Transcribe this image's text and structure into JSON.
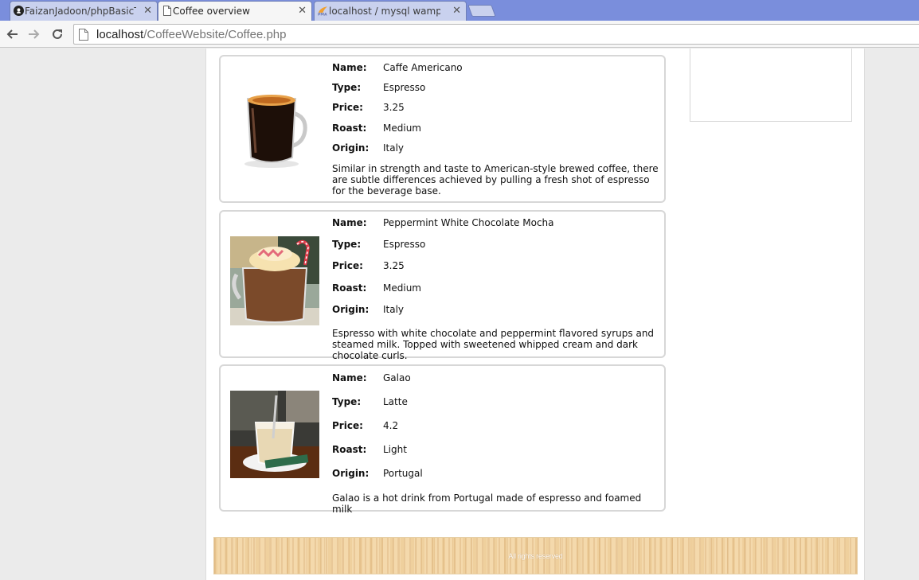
{
  "browser": {
    "tabs": [
      {
        "title": "FaizanJadoon/phpBasicTe",
        "icon": "github-icon"
      },
      {
        "title": "Coffee overview",
        "icon": "page-icon"
      },
      {
        "title": "localhost / mysql wampse",
        "icon": "phpmyadmin-icon"
      }
    ],
    "url": {
      "host": "localhost",
      "path": "/CoffeeWebsite/Coffee.php"
    }
  },
  "labels": {
    "name": "Name:",
    "type": "Type:",
    "price": "Price:",
    "roast": "Roast:",
    "origin": "Origin:"
  },
  "coffees": [
    {
      "name": "Caffe Americano",
      "type": "Espresso",
      "price": "3.25",
      "roast": "Medium",
      "origin": "Italy",
      "description": "Similar in strength and taste to American-style brewed coffee, there are subtle differences achieved by pulling a fresh shot of espresso for the beverage base.",
      "image": "americano-glass-image"
    },
    {
      "name": "Peppermint White Chocolate Mocha",
      "type": "Espresso",
      "price": "3.25",
      "roast": "Medium",
      "origin": "Italy",
      "description": "Espresso with white chocolate and peppermint flavored syrups and steamed milk. Topped with sweetened whipped cream and dark chocolate curls.",
      "image": "mocha-whipped-cream-image"
    },
    {
      "name": "Galao",
      "type": "Latte",
      "price": "4.2",
      "roast": "Light",
      "origin": "Portugal",
      "description": "Galao is a hot drink from Portugal made of espresso and foamed milk",
      "image": "galao-glass-image"
    }
  ],
  "footer": {
    "text": "All rights reserved"
  }
}
